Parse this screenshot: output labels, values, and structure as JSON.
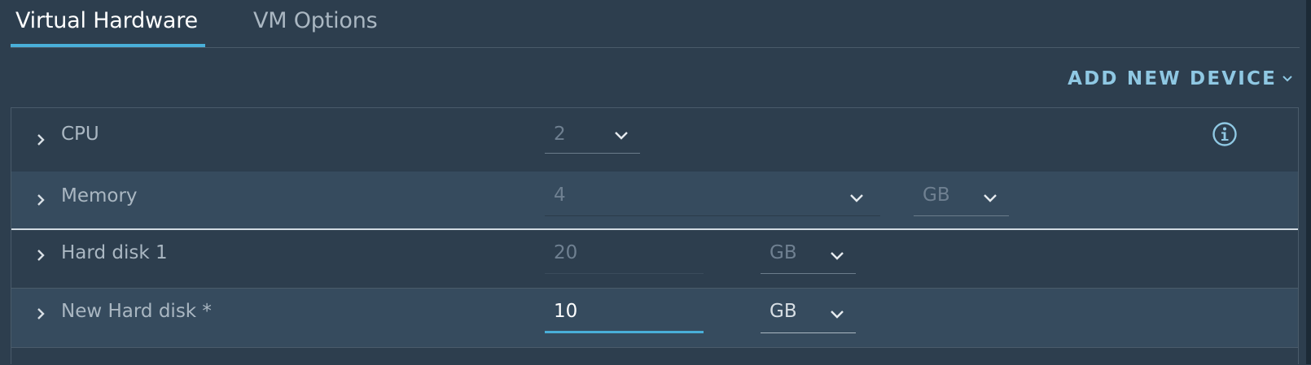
{
  "tabs": [
    {
      "label": "Virtual Hardware",
      "active": true
    },
    {
      "label": "VM Options",
      "active": false
    }
  ],
  "toolbar": {
    "add_device_label": "ADD NEW DEVICE",
    "add_device_icon": "chevron-down-icon"
  },
  "colors": {
    "background": "#2d3e4e",
    "row_alt": "#364b5e",
    "accent": "#49afd9",
    "link": "#8fc8e3"
  },
  "devices": [
    {
      "label": "CPU",
      "value": "2",
      "icon": "info-icon"
    },
    {
      "label": "Memory",
      "value": "4",
      "unit": "GB"
    },
    {
      "label": "Hard disk 1",
      "value": "20",
      "unit": "GB"
    },
    {
      "label": "New Hard disk *",
      "value": "10",
      "unit": "GB"
    }
  ]
}
